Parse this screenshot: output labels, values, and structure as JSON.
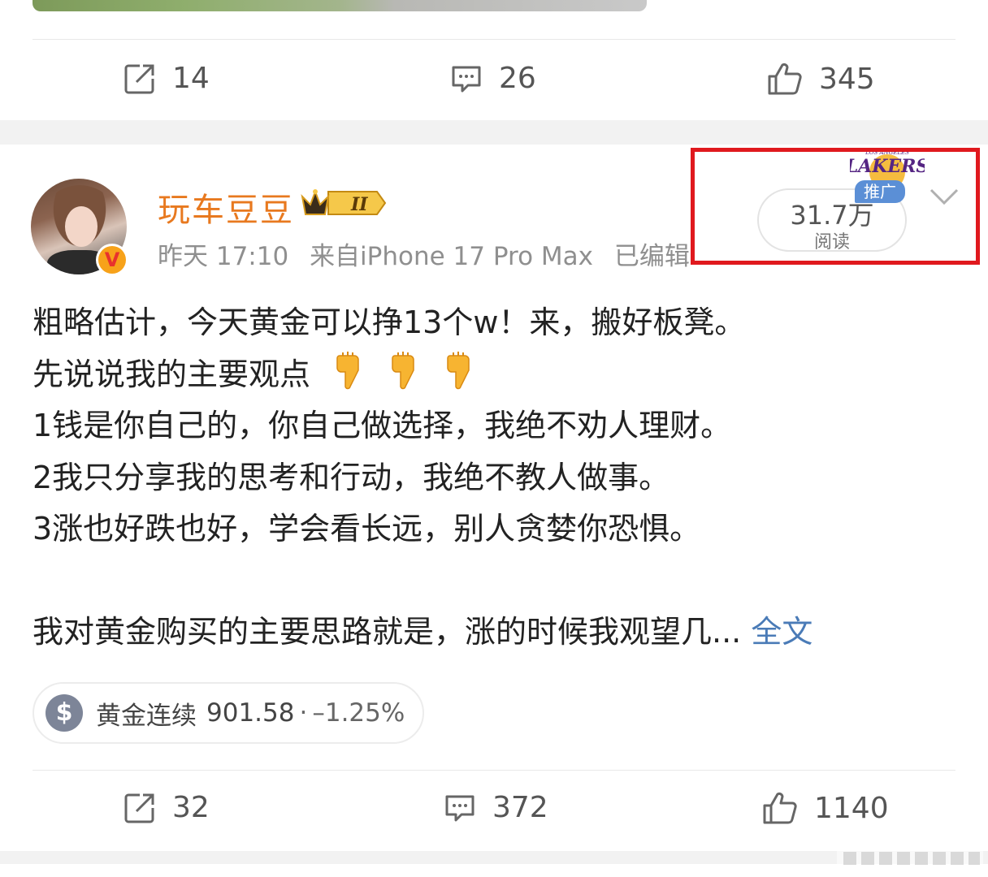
{
  "prev_post": {
    "actions": {
      "repost": "14",
      "comment": "26",
      "like": "345"
    }
  },
  "post": {
    "author": {
      "name": "玩车豆豆",
      "verified_badge": "V",
      "vip_level": "II"
    },
    "meta": {
      "time": "昨天 17:10",
      "source": "来自iPhone 17 Pro Max",
      "edited": "已编辑"
    },
    "reads": {
      "count": "31.7万",
      "label": "阅读"
    },
    "promo": {
      "label": "推广",
      "logo_text": "LAKERS"
    },
    "text_lines": [
      "粗略估计，今天黄金可以挣13个w！来，搬好板凳。",
      "先说说我的主要观点",
      "1钱是你自己的，你自己做选择，我绝不劝人理财。",
      "2我只分享我的思考和行动，我绝不教人做事。",
      "3涨也好跌也好，学会看长远，别人贪婪你恐惧。",
      "",
      "我对黄金购买的主要思路就是，涨的时候我观望几..."
    ],
    "full_text_link": "全文",
    "emoji": "finger-pointing-down-icon",
    "stock": {
      "icon": "$",
      "name": "黄金连续",
      "price": "901.58",
      "separator": "·",
      "change": "–1.25%"
    },
    "actions": {
      "repost": "32",
      "comment": "372",
      "like": "1140"
    }
  },
  "colors": {
    "username": "#e8791f",
    "link": "#4a7bb7",
    "highlight_border": "#e0191e",
    "promo_badge": "#5b8fd6"
  }
}
